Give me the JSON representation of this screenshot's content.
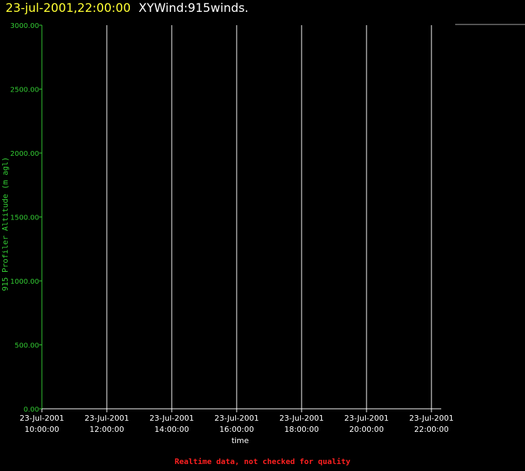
{
  "header": {
    "timestamp": "23-jul-2001,22:00:00",
    "dataset": "XYWind:915winds."
  },
  "footer": {
    "quality_note": "Realtime data, not checked for quality"
  },
  "colors": {
    "background": "#000000",
    "title_date": "#ffff33",
    "title_name": "#ffffff",
    "y_axis": "#33cc33",
    "x_axis": "#ffffff",
    "grid": "#ffffff",
    "warning": "#ff2020"
  },
  "chart_data": {
    "type": "line",
    "xlabel": "time",
    "ylabel": "915 Profiler Altitude (m agl)",
    "ylim": [
      0,
      3000
    ],
    "y_ticks": [
      {
        "value": 0,
        "label": "0.00"
      },
      {
        "value": 500,
        "label": "500.00"
      },
      {
        "value": 1000,
        "label": "1000.00"
      },
      {
        "value": 1500,
        "label": "1500.00"
      },
      {
        "value": 2000,
        "label": "2000.00"
      },
      {
        "value": 2500,
        "label": "2500.00"
      },
      {
        "value": 3000,
        "label": "3000.00"
      }
    ],
    "xlim": [
      "23-Jul-2001 10:00:00",
      "23-Jul-2001 22:00:00"
    ],
    "x_ticks": [
      {
        "value": "23-Jul-2001 10:00:00",
        "date": "23-Jul-2001",
        "time": "10:00:00"
      },
      {
        "value": "23-Jul-2001 12:00:00",
        "date": "23-Jul-2001",
        "time": "12:00:00"
      },
      {
        "value": "23-Jul-2001 14:00:00",
        "date": "23-Jul-2001",
        "time": "14:00:00"
      },
      {
        "value": "23-Jul-2001 16:00:00",
        "date": "23-Jul-2001",
        "time": "16:00:00"
      },
      {
        "value": "23-Jul-2001 18:00:00",
        "date": "23-Jul-2001",
        "time": "18:00:00"
      },
      {
        "value": "23-Jul-2001 20:00:00",
        "date": "23-Jul-2001",
        "time": "20:00:00"
      },
      {
        "value": "23-Jul-2001 22:00:00",
        "date": "23-Jul-2001",
        "time": "22:00:00"
      }
    ],
    "vertical_grid": true,
    "horizontal_grid": false,
    "series": []
  }
}
